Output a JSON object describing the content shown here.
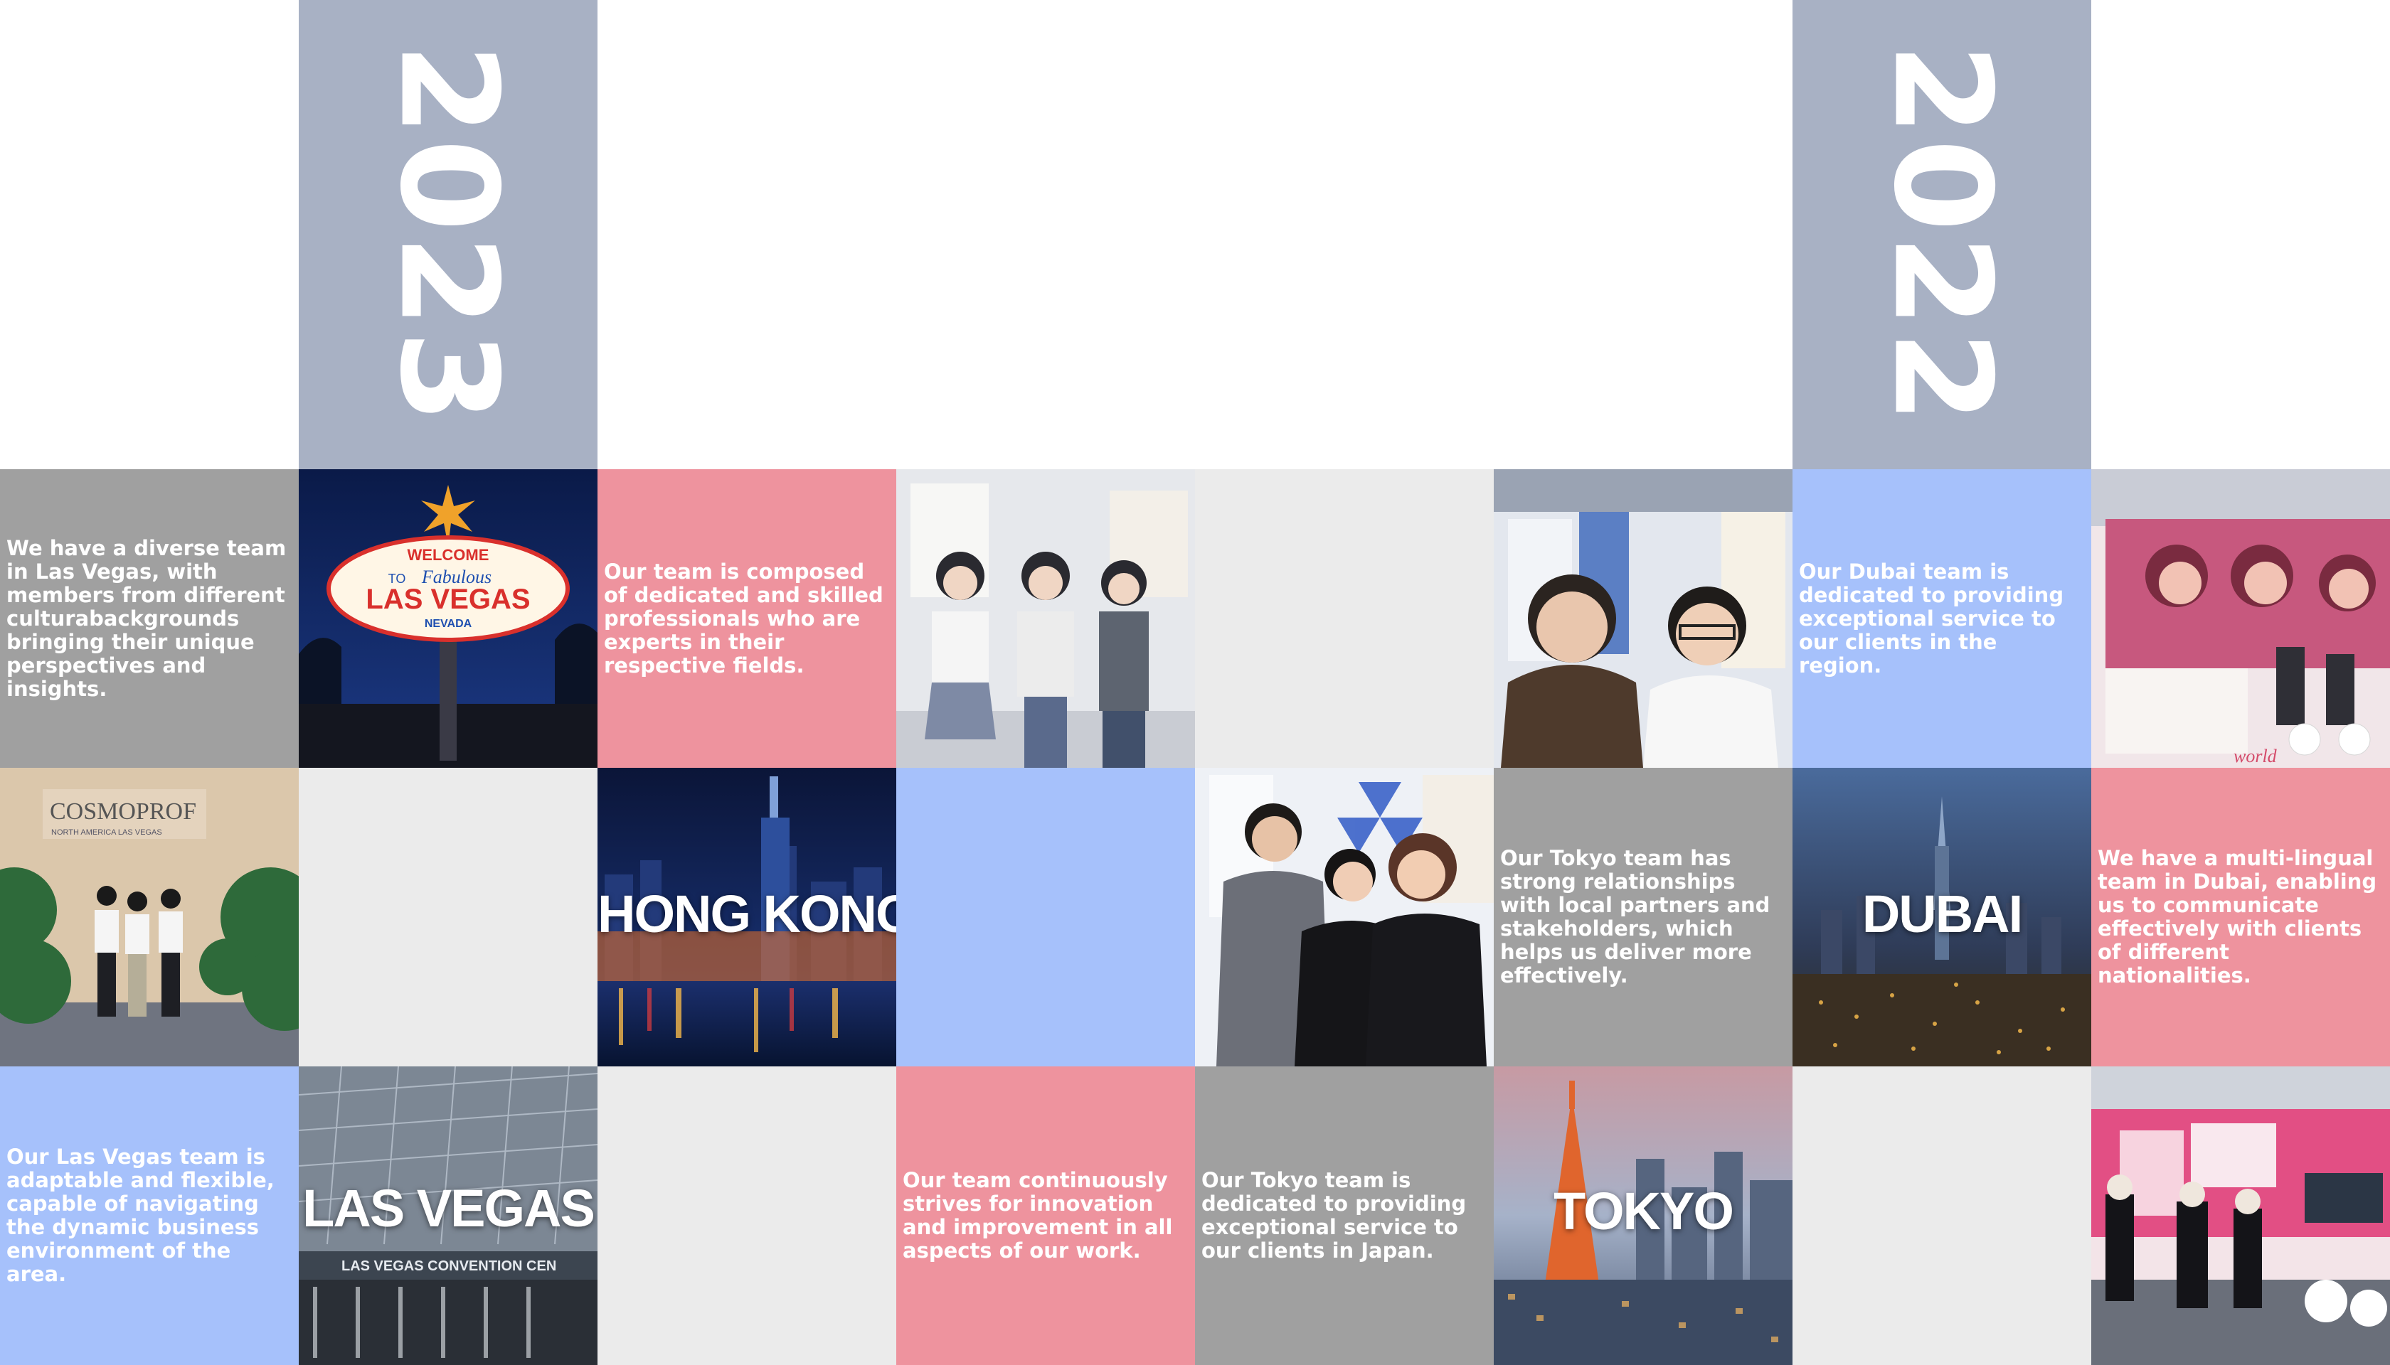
{
  "years": [
    "2023",
    "2022"
  ],
  "texts": {
    "lv_diverse": "We have a diverse team in Las Vegas, with members from different culturabackgrounds bringing their unique perspectives and insights.",
    "team_composed": "Our team is composed of dedicated and skilled professionals who are experts in their respective fields.",
    "dubai_dedicated": "Our Dubai team is dedicated to providing exceptional service to our clients in the region.",
    "tokyo_relationships": "Our Tokyo team has strong relationships with local partners and stakeholders, which helps us deliver more effectively.",
    "dubai_multilingual": "We have a multi-lingual team in Dubai, enabling us to communicate effectively with clients of different nationalities.",
    "lv_adaptable": "Our Las Vegas team is adaptable and flexible, capable of navigating the dynamic business environment of the area.",
    "team_innovation": "Our team continuously strives for innovation and improvement in all aspects of our work.",
    "tokyo_dedicated": "Our Tokyo team is dedicated to providing exceptional service to our clients in Japan."
  },
  "cities": {
    "hongkong": "HONG KONG",
    "dubai": "DUBAI",
    "lasvegas": "LAS VEGAS",
    "tokyo": "TOKYO"
  },
  "sign": {
    "welcome": "WELCOME",
    "to": "TO",
    "fabulous": "Fabulous",
    "lasvegas": "LAS VEGAS",
    "nevada": "NEVADA"
  },
  "booth": {
    "cosmoprof": "COSMOPROF",
    "cosmoprof_sub": "NORTH AMERICA LAS VEGAS",
    "convention": "LAS VEGAS CONVENTION CEN",
    "world": "world"
  },
  "colors": {
    "year_bg": "#a8b1c4",
    "gray": "#a0a0a0",
    "pink": "#ee939e",
    "blue": "#a6c1fb",
    "light": "#ebebeb"
  }
}
